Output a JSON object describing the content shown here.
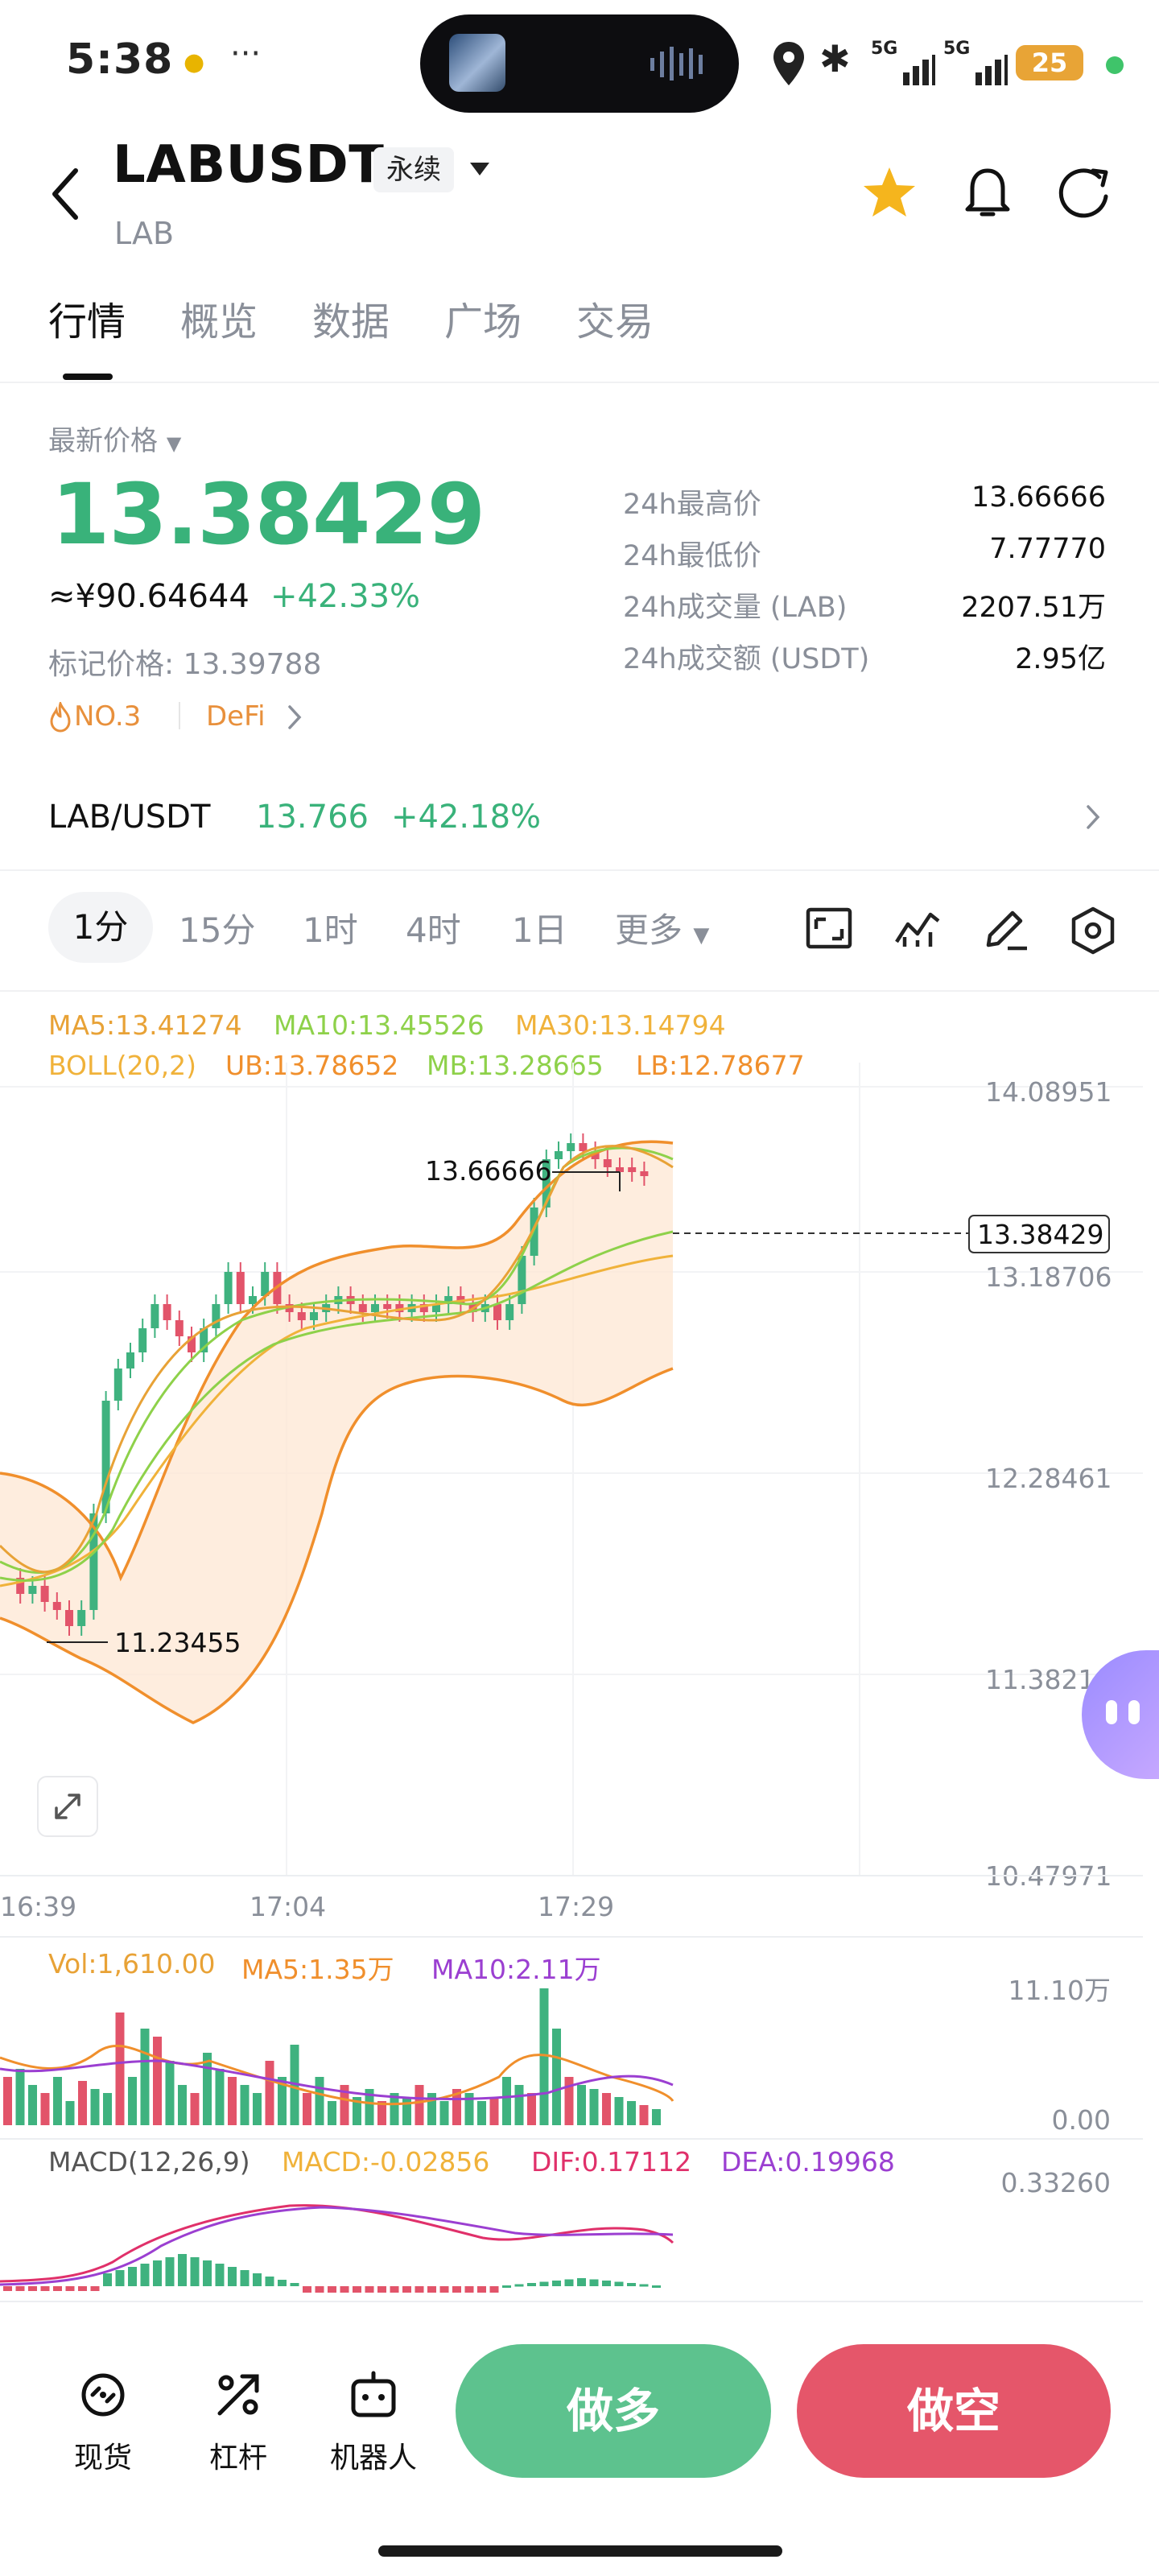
{
  "status_bar": {
    "time": "5:38",
    "battery": "25",
    "net1": "5G",
    "net2": "5G"
  },
  "header": {
    "title": "LABUSDT",
    "tag": "永续",
    "subtitle": "LAB"
  },
  "tabs": [
    {
      "label": "行情"
    },
    {
      "label": "概览"
    },
    {
      "label": "数据"
    },
    {
      "label": "广场"
    },
    {
      "label": "交易"
    }
  ],
  "price": {
    "label": "最新价格",
    "last": "13.38429",
    "cny": "≈¥90.64644",
    "change_pct": "+42.33%",
    "mark_price": "标记价格: 13.39788",
    "rank": "NO.3",
    "category": "DeFi"
  },
  "stats": [
    {
      "label": "24h最高价",
      "value": "13.66666"
    },
    {
      "label": "24h最低价",
      "value": "7.77770"
    },
    {
      "label": "24h成交量 (LAB)",
      "value": "2207.51万"
    },
    {
      "label": "24h成交额 (USDT)",
      "value": "2.95亿"
    }
  ],
  "spot_pair": {
    "name": "LAB/USDT",
    "price": "13.766",
    "change_pct": "+42.18%"
  },
  "intervals": [
    {
      "label": "1分"
    },
    {
      "label": "15分"
    },
    {
      "label": "1时"
    },
    {
      "label": "4时"
    },
    {
      "label": "1日"
    },
    {
      "label": "更多"
    }
  ],
  "indicators": {
    "ma5": "MA5:13.41274",
    "ma10": "MA10:13.45526",
    "ma30": "MA30:13.14794",
    "boll": "BOLL(20,2)",
    "ub": "UB:13.78652",
    "mb": "MB:13.28665",
    "lb": "LB:12.78677",
    "vol": "Vol:1,610.00",
    "vol_ma5": "MA5:1.35万",
    "vol_ma10": "MA10:2.11万",
    "macd_title": "MACD(12,26,9)",
    "macd": "MACD:-0.02856",
    "dif": "DIF:0.17112",
    "dea": "DEA:0.19968"
  },
  "chart_data": {
    "type": "candlestick",
    "y_axis_labels": [
      "14.08951",
      "13.18706",
      "12.28461",
      "11.38216",
      "10.47971"
    ],
    "x_axis_labels": [
      "16:39",
      "17:04",
      "17:29"
    ],
    "high_marker": "13.66666",
    "low_marker": "11.23455",
    "last_price_tag": "13.38429",
    "volume_axis_labels": [
      "11.10万",
      "0.00"
    ],
    "macd_axis_label": "0.33260",
    "colors": {
      "up": "#3fb27f",
      "down": "#e2546a",
      "ma5": "#e8a236",
      "ma10": "#8ed14a",
      "ma30": "#f0b23a",
      "boll": "#f08f2c",
      "dif": "#e0306a",
      "dea": "#9b3fd1"
    }
  },
  "bottom_nav": [
    {
      "label": "现货"
    },
    {
      "label": "杠杆"
    },
    {
      "label": "机器人"
    }
  ],
  "actions": {
    "buy": "做多",
    "sell": "做空"
  }
}
